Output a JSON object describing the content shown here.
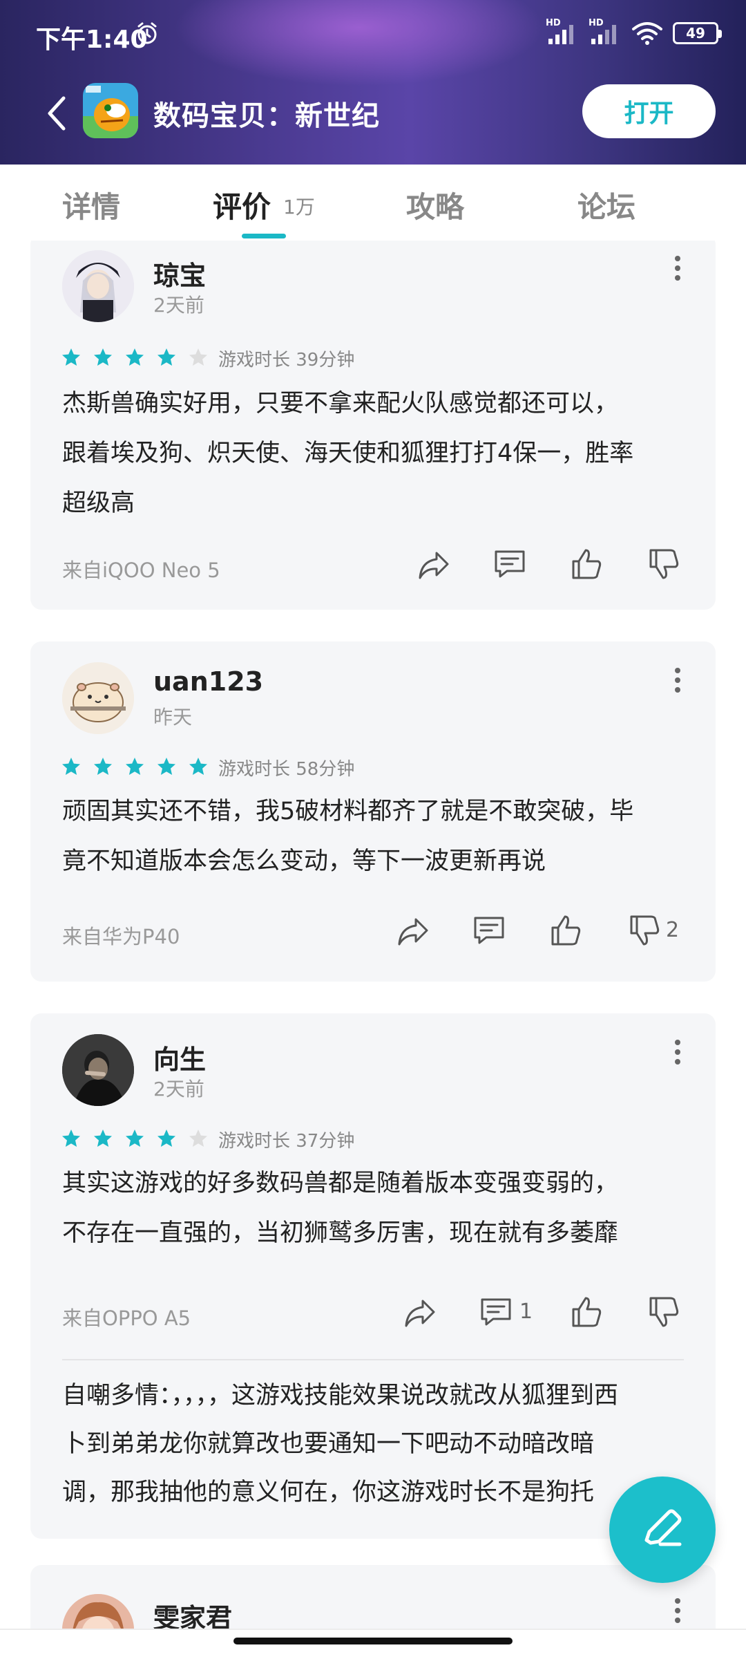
{
  "status_bar": {
    "time": "下午1:40",
    "battery": "49",
    "network_label_1": "HD",
    "network_label_2": "HD"
  },
  "header": {
    "app_title": "数码宝贝：新世纪",
    "open_label": "打开"
  },
  "tabs": [
    {
      "label": "详情"
    },
    {
      "label": "评价",
      "count": "1万"
    },
    {
      "label": "攻略"
    },
    {
      "label": "论坛"
    }
  ],
  "reviews": [
    {
      "username": "琼宝",
      "time": "2天前",
      "rating": 4,
      "playtime": "游戏时长 39分钟",
      "lines": [
        "杰斯兽确实好用，只要不拿来配火队感觉都还可以，",
        "跟着埃及狗、炽天使、海天使和狐狸打打4保一，胜率",
        "超级高"
      ],
      "device": "来自iQOO Neo 5"
    },
    {
      "username": "uan123",
      "time": "昨天",
      "rating": 5,
      "playtime": "游戏时长 58分钟",
      "lines": [
        "顽固其实还不错，我5破材料都齐了就是不敢突破，毕",
        "竟不知道版本会怎么变动，等下一波更新再说"
      ],
      "device": "来自华为P40",
      "dislike_count": "2"
    },
    {
      "username": "向生",
      "time": "2天前",
      "rating": 4,
      "playtime": "游戏时长 37分钟",
      "lines": [
        "其实这游戏的好多数码兽都是随着版本变强变弱的，",
        "不存在一直强的，当初狮鹫多厉害，现在就有多萎靡"
      ],
      "device": "来自OPPO A5",
      "comment_count": "1",
      "reply_lines": [
        "自嘲多情：，，，，这游戏技能效果说改就改从狐狸到西",
        "卜到弟弟龙你就算改也要通知一下吧动不动暗改暗",
        "调，那我抽他的意义何在，你这游戏时长不是狗托"
      ]
    },
    {
      "username": "雯家君"
    }
  ],
  "colors": {
    "accent": "#1bb8c6",
    "star_filled": "#1bb8c6",
    "star_empty": "#dddddd",
    "card_bg": "#f5f6f8"
  }
}
